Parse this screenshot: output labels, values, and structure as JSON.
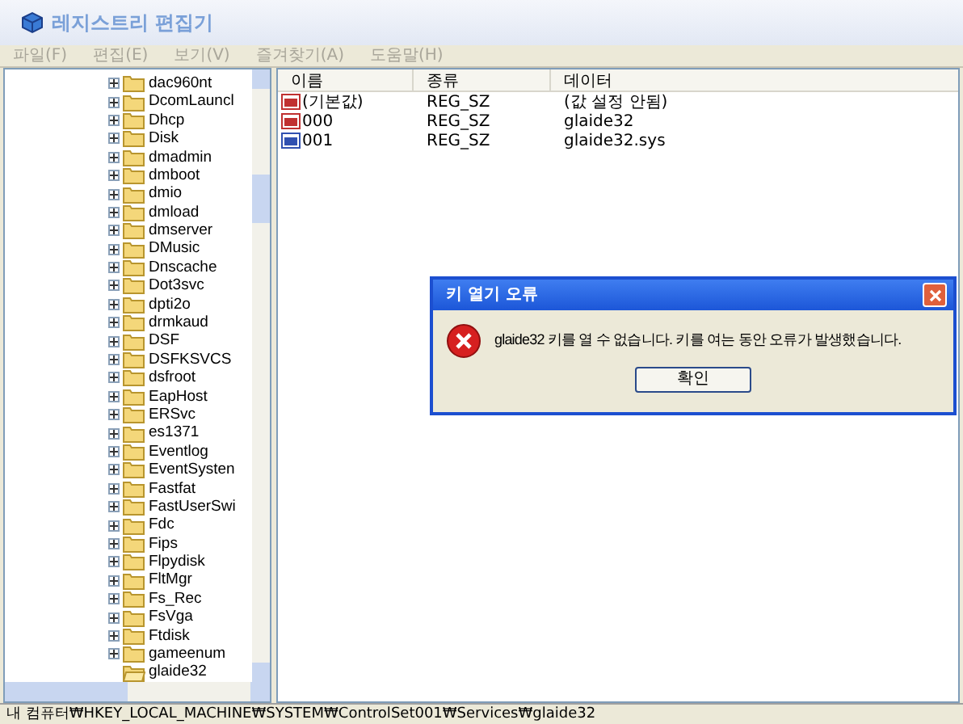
{
  "window": {
    "title": "레지스트리 편집기"
  },
  "menu": [
    {
      "label": "파일(F)",
      "disabled": true
    },
    {
      "label": "편집(E)",
      "disabled": true
    },
    {
      "label": "보기(V)",
      "disabled": true
    },
    {
      "label": "즐겨찾기(A)",
      "disabled": true
    },
    {
      "label": "도움말(H)",
      "disabled": true
    }
  ],
  "tree": [
    {
      "label": "dac960nt",
      "expandable": true
    },
    {
      "label": "DcomLauncl",
      "expandable": true
    },
    {
      "label": "Dhcp",
      "expandable": true
    },
    {
      "label": "Disk",
      "expandable": true
    },
    {
      "label": "dmadmin",
      "expandable": true
    },
    {
      "label": "dmboot",
      "expandable": true
    },
    {
      "label": "dmio",
      "expandable": true
    },
    {
      "label": "dmload",
      "expandable": true
    },
    {
      "label": "dmserver",
      "expandable": true
    },
    {
      "label": "DMusic",
      "expandable": true
    },
    {
      "label": "Dnscache",
      "expandable": true
    },
    {
      "label": "Dot3svc",
      "expandable": true
    },
    {
      "label": "dpti2o",
      "expandable": true
    },
    {
      "label": "drmkaud",
      "expandable": true
    },
    {
      "label": "DSF",
      "expandable": true
    },
    {
      "label": "DSFKSVCS",
      "expandable": true
    },
    {
      "label": "dsfroot",
      "expandable": true
    },
    {
      "label": "EapHost",
      "expandable": true
    },
    {
      "label": "ERSvc",
      "expandable": true
    },
    {
      "label": "es1371",
      "expandable": true
    },
    {
      "label": "Eventlog",
      "expandable": true
    },
    {
      "label": "EventSysten",
      "expandable": true
    },
    {
      "label": "Fastfat",
      "expandable": true
    },
    {
      "label": "FastUserSwi",
      "expandable": true
    },
    {
      "label": "Fdc",
      "expandable": true
    },
    {
      "label": "Fips",
      "expandable": true
    },
    {
      "label": "Flpydisk",
      "expandable": true
    },
    {
      "label": "FltMgr",
      "expandable": true
    },
    {
      "label": "Fs_Rec",
      "expandable": true
    },
    {
      "label": "FsVga",
      "expandable": true
    },
    {
      "label": "Ftdisk",
      "expandable": true
    },
    {
      "label": "gameenum",
      "expandable": true
    },
    {
      "label": "glaide32",
      "expandable": false
    }
  ],
  "table": {
    "columns": [
      "이름",
      "종류",
      "데이터"
    ],
    "rows": [
      {
        "name": "(기본값)",
        "type": "REG_SZ",
        "data": "(값 설정 안됨)",
        "color": "#c03030"
      },
      {
        "name": "000",
        "type": "REG_SZ",
        "data": "glaide32",
        "color": "#c03030"
      },
      {
        "name": "001",
        "type": "REG_SZ",
        "data": "glaide32.sys",
        "color": "#3050b0"
      }
    ]
  },
  "dialog": {
    "title": "키 열기 오류",
    "message": "glaide32 키를 열 수 없습니다. 키를 여는 동안 오류가 발생했습니다.",
    "button": "확인"
  },
  "status_bar": "내 컴퓨터₩HKEY_LOCAL_MACHINE₩SYSTEM₩ControlSet001₩Services₩glaide32"
}
